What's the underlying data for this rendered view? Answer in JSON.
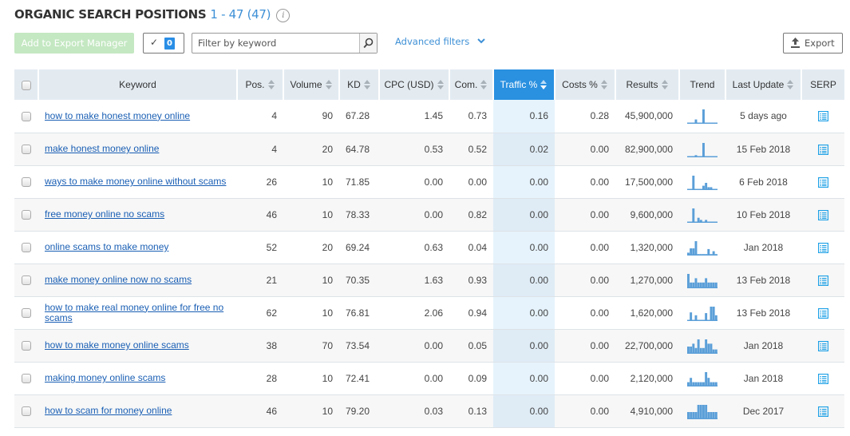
{
  "header": {
    "title": "ORGANIC SEARCH POSITIONS",
    "range": "1 - 47 (47)",
    "info_icon": "info-icon"
  },
  "toolbar": {
    "add_export_label": "Add to Export Manager",
    "selected_count": "0",
    "filter_placeholder": "Filter by keyword",
    "filter_value": "",
    "advanced_filters_label": "Advanced filters",
    "export_label": "Export"
  },
  "table": {
    "columns": [
      "Keyword",
      "Pos.",
      "Volume",
      "KD",
      "CPC (USD)",
      "Com.",
      "Traffic %",
      "Costs %",
      "Results",
      "Trend",
      "Last Update",
      "SERP"
    ],
    "sorted_column": "Traffic %",
    "rows": [
      {
        "keyword": "how to make honest money online",
        "pos": "4",
        "volume": "90",
        "kd": "67.28",
        "cpc": "1.45",
        "com": "0.73",
        "traffic": "0.16",
        "costs": "0.28",
        "results": "45,900,000",
        "trend": [
          0,
          0,
          0,
          0.3,
          0,
          0,
          1,
          0.08,
          0,
          0.08,
          0,
          0
        ],
        "last_update": "5 days ago"
      },
      {
        "keyword": "make honest money online",
        "pos": "4",
        "volume": "20",
        "kd": "64.78",
        "cpc": "0.53",
        "com": "0.52",
        "traffic": "0.02",
        "costs": "0.00",
        "results": "82,900,000",
        "trend": [
          0,
          0,
          0,
          0.15,
          0,
          0,
          1,
          0,
          0,
          0,
          0,
          0
        ],
        "last_update": "15 Feb 2018"
      },
      {
        "keyword": "ways to make money online without scams",
        "pos": "26",
        "volume": "10",
        "kd": "71.85",
        "cpc": "0.00",
        "com": "0.00",
        "traffic": "0.00",
        "costs": "0.00",
        "results": "17,500,000",
        "trend": [
          0,
          0,
          1,
          0,
          0,
          0,
          0.3,
          0.5,
          0.2,
          0.2,
          0,
          0
        ],
        "last_update": "6 Feb 2018"
      },
      {
        "keyword": "free money online no scams",
        "pos": "46",
        "volume": "10",
        "kd": "78.33",
        "cpc": "0.00",
        "com": "0.82",
        "traffic": "0.00",
        "costs": "0.00",
        "results": "9,600,000",
        "trend": [
          0,
          0,
          1,
          0,
          0.35,
          0.2,
          0,
          0.2,
          0,
          0,
          0,
          0
        ],
        "last_update": "10 Feb 2018"
      },
      {
        "keyword": "online scams to make money",
        "pos": "52",
        "volume": "20",
        "kd": "69.24",
        "cpc": "0.63",
        "com": "0.04",
        "traffic": "0.00",
        "costs": "0.00",
        "results": "1,320,000",
        "trend": [
          0.2,
          0.5,
          0.5,
          1,
          0.1,
          0.1,
          0.1,
          0.1,
          0.45,
          0.1,
          0.3,
          0.1
        ],
        "last_update": "Jan 2018"
      },
      {
        "keyword": "make money online now no scams",
        "pos": "21",
        "volume": "10",
        "kd": "70.35",
        "cpc": "1.63",
        "com": "0.93",
        "traffic": "0.00",
        "costs": "0.00",
        "results": "1,270,000",
        "trend": [
          1,
          0.4,
          0.4,
          0.7,
          0.4,
          0.4,
          0.4,
          0.7,
          0.4,
          0.4,
          0.4,
          0.4
        ],
        "last_update": "13 Feb 2018"
      },
      {
        "keyword": "how to make real money online for free no scams",
        "pos": "62",
        "volume": "10",
        "kd": "76.81",
        "cpc": "2.06",
        "com": "0.94",
        "traffic": "0.00",
        "costs": "0.00",
        "results": "1,620,000",
        "trend": [
          0,
          0.6,
          0,
          0.4,
          0,
          0,
          0,
          0.55,
          0,
          1,
          1,
          0.4
        ],
        "last_update": "13 Feb 2018"
      },
      {
        "keyword": "how to make money online scams",
        "pos": "38",
        "volume": "70",
        "kd": "73.54",
        "cpc": "0.00",
        "com": "0.05",
        "traffic": "0.00",
        "costs": "0.00",
        "results": "22,700,000",
        "trend": [
          0.5,
          0.5,
          0.7,
          0.4,
          1,
          0.4,
          0.4,
          1,
          0.7,
          0.7,
          0.3,
          0.3
        ],
        "last_update": "Jan 2018"
      },
      {
        "keyword": "making money online scams",
        "pos": "28",
        "volume": "10",
        "kd": "72.41",
        "cpc": "0.00",
        "com": "0.09",
        "traffic": "0.00",
        "costs": "0.00",
        "results": "2,120,000",
        "trend": [
          0.3,
          0.6,
          0.3,
          0.3,
          0.3,
          0.3,
          0.3,
          1,
          0.6,
          0.3,
          0.3,
          0.3
        ],
        "last_update": "Jan 2018"
      },
      {
        "keyword": "how to scam for money online",
        "pos": "46",
        "volume": "10",
        "kd": "79.20",
        "cpc": "0.03",
        "com": "0.13",
        "traffic": "0.00",
        "costs": "0.00",
        "results": "4,910,000",
        "trend": [
          0.5,
          0.5,
          0.5,
          0.5,
          1,
          1,
          1,
          1,
          0.5,
          0.5,
          0.5,
          0.5
        ],
        "last_update": "Dec 2017"
      }
    ]
  },
  "colors": {
    "accent": "#2a90e0",
    "link": "#1a5fb4",
    "trend_bar": "#5b9fd8",
    "serp_icon": "#1ea1e6",
    "export_manager_disabled": "#c4e8c2"
  }
}
